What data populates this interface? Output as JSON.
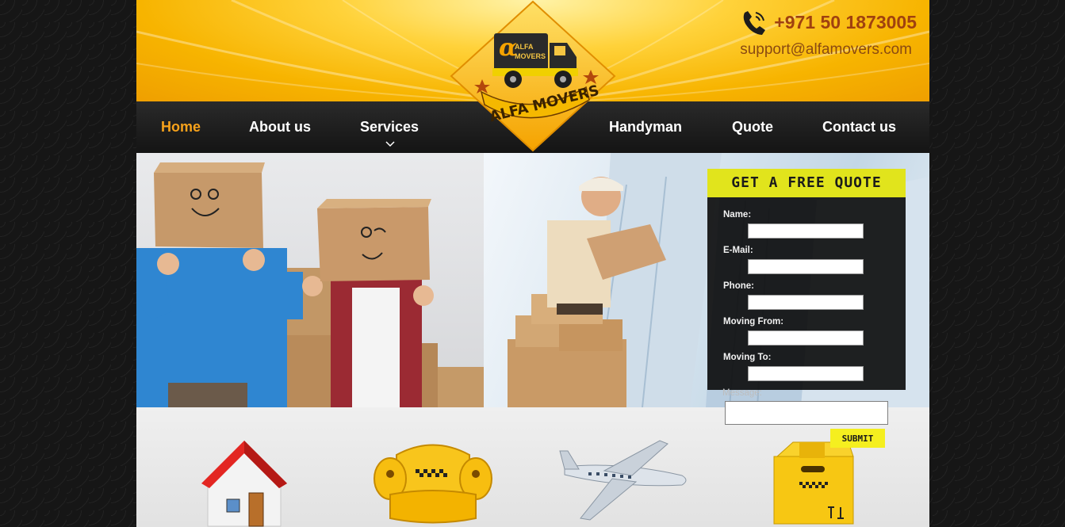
{
  "header": {
    "phone": "+971 50 1873005",
    "email": "support@alfamovers.com",
    "logo_alpha": "α",
    "logo_badge_top": "ALFA",
    "logo_badge_bottom": "MOVERS",
    "logo_text": "ALFA MOVERS"
  },
  "nav": {
    "items": [
      {
        "label": "Home",
        "active": true
      },
      {
        "label": "About us"
      },
      {
        "label": "Services",
        "has_dropdown": true
      },
      {
        "label": "Handyman"
      },
      {
        "label": "Quote"
      },
      {
        "label": "Contact us"
      }
    ]
  },
  "quote_form": {
    "title": "GET A FREE QUOTE",
    "fields": [
      {
        "label": "Name:"
      },
      {
        "label": "E-Mail:"
      },
      {
        "label": "Phone:"
      },
      {
        "label": "Moving From:"
      },
      {
        "label": "Moving To:"
      }
    ],
    "message_label": "Message:",
    "submit_label": "SUBMIT"
  },
  "services": {
    "icons": [
      "house-icon",
      "armchair-icon",
      "airplane-icon",
      "cardboard-box-icon"
    ]
  },
  "colors": {
    "header_yellow": "#f7b400",
    "nav_active": "#f7a21b",
    "phone_text": "#a0410f",
    "quote_head": "#e1e41c",
    "submit": "#f5ef1f"
  }
}
